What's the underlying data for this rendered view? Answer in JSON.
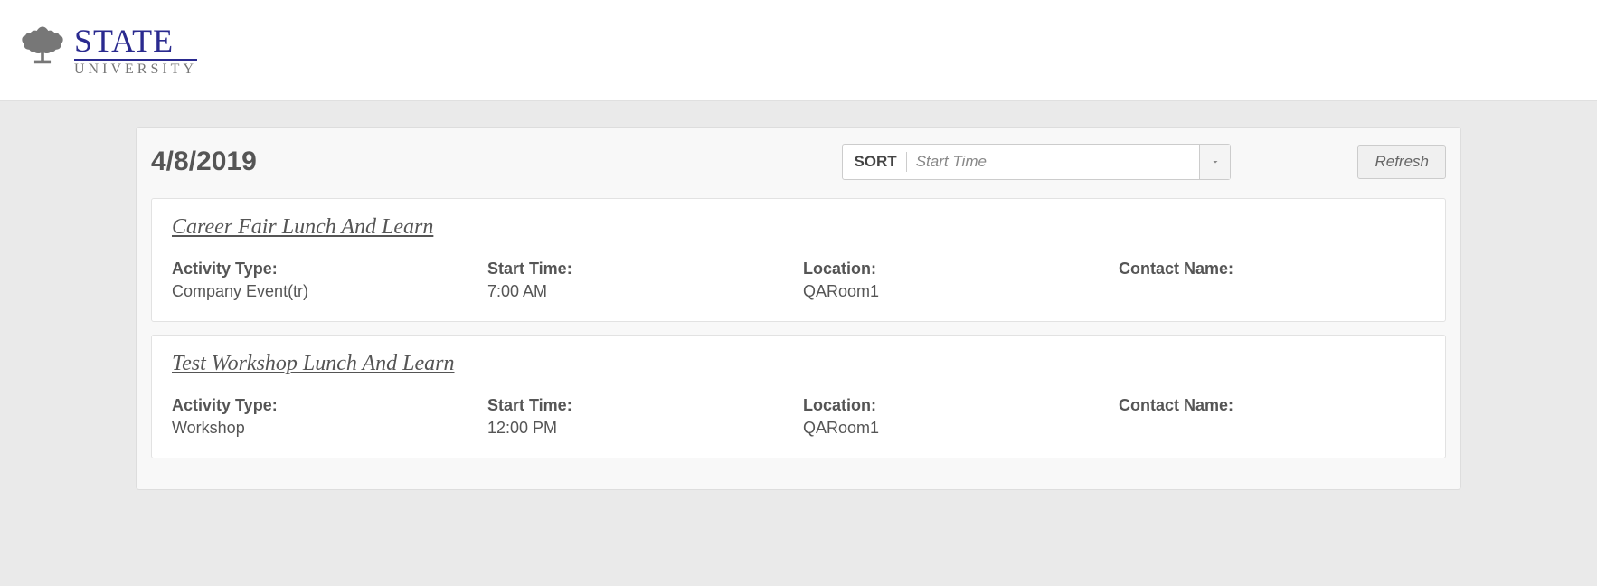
{
  "logo": {
    "line1": "STATE",
    "line2": "UNIVERSITY"
  },
  "date": "4/8/2019",
  "sort": {
    "label": "SORT",
    "value": "Start Time"
  },
  "refresh_label": "Refresh",
  "field_labels": {
    "activity_type": "Activity Type:",
    "start_time": "Start Time:",
    "location": "Location:",
    "contact_name": "Contact Name:"
  },
  "events": [
    {
      "title": "Career Fair Lunch And Learn",
      "activity_type": "Company Event(tr)",
      "start_time": "7:00 AM",
      "location": "QARoom1",
      "contact_name": ""
    },
    {
      "title": "Test Workshop Lunch And Learn",
      "activity_type": "Workshop",
      "start_time": "12:00 PM",
      "location": "QARoom1",
      "contact_name": ""
    }
  ]
}
